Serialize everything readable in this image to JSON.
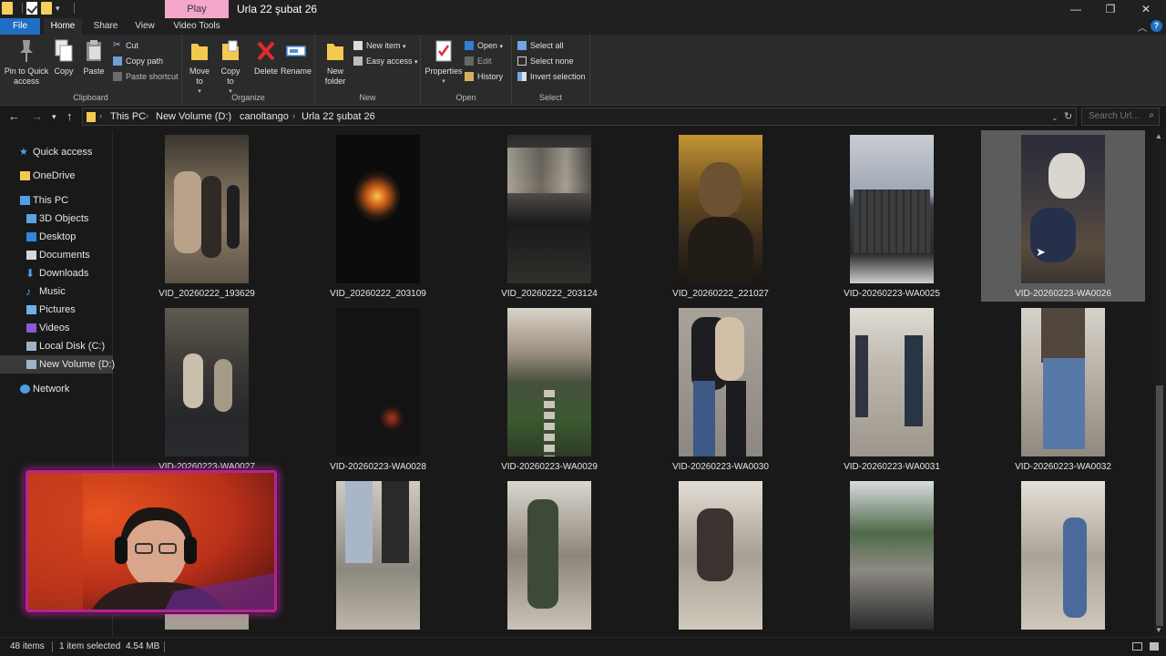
{
  "window": {
    "title": "Urla 22 şubat 26",
    "contextual_tab": "Play",
    "minimize": "—",
    "maximize": "❐",
    "close": "✕"
  },
  "ribbon_tabs": [
    "File",
    "Home",
    "Share",
    "View",
    "Video Tools"
  ],
  "ribbon": {
    "clipboard": {
      "label": "Clipboard",
      "pin": "Pin to Quick access",
      "copy": "Copy",
      "paste": "Paste",
      "cut": "Cut",
      "copy_path": "Copy path",
      "paste_shortcut": "Paste shortcut"
    },
    "organize": {
      "label": "Organize",
      "move_to": "Move to",
      "copy_to": "Copy to",
      "delete": "Delete",
      "rename": "Rename"
    },
    "new": {
      "label": "New",
      "new_folder": "New folder",
      "new_item": "New item",
      "easy_access": "Easy access"
    },
    "open": {
      "label": "Open",
      "properties": "Properties",
      "open": "Open",
      "edit": "Edit",
      "history": "History"
    },
    "select": {
      "label": "Select",
      "select_all": "Select all",
      "select_none": "Select none",
      "invert": "Invert selection"
    }
  },
  "address": {
    "breadcrumbs": [
      "This PC",
      "New Volume (D:)",
      "canoltango",
      "Urla 22 şubat 26"
    ],
    "search_placeholder": "Search Url..."
  },
  "nav": {
    "quick_access": "Quick access",
    "onedrive": "OneDrive",
    "this_pc": "This PC",
    "objects3d": "3D Objects",
    "desktop": "Desktop",
    "documents": "Documents",
    "downloads": "Downloads",
    "music": "Music",
    "pictures": "Pictures",
    "videos": "Videos",
    "local_disk": "Local Disk (C:)",
    "new_volume": "New Volume (D:)",
    "network": "Network"
  },
  "files": [
    "VID_20260222_193629",
    "VID_20260222_203109",
    "VID_20260222_203124",
    "VID_20260222_221027",
    "VID-20260223-WA0025",
    "VID-20260223-WA0026",
    "VID-20260223-WA0027",
    "VID-20260223-WA0028",
    "VID-20260223-WA0029",
    "VID-20260223-WA0030",
    "VID-20260223-WA0031",
    "VID-20260223-WA0032"
  ],
  "status": {
    "count": "48 items",
    "selection": "1 item selected",
    "size": "4.54 MB"
  },
  "colors": {
    "accent": "#1e6fc3",
    "play_tab": "#f4a7c9",
    "webcam_border": "#b0268f"
  }
}
